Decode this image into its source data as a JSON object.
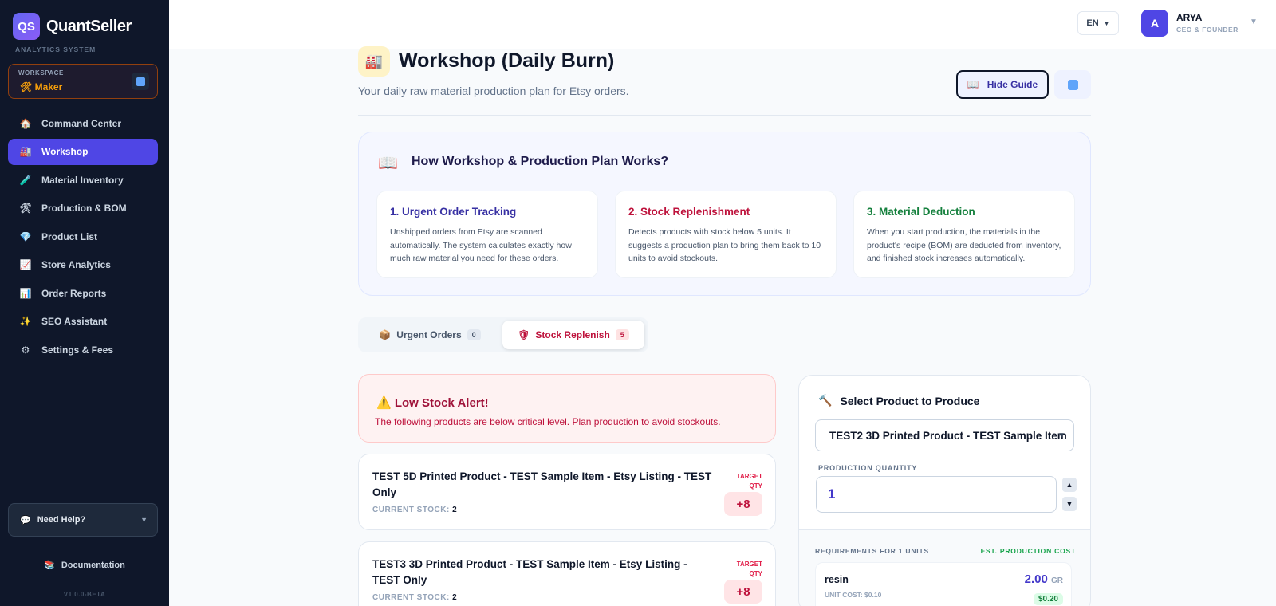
{
  "brand": {
    "logo": "QS",
    "name": "QuantSeller",
    "subtitle": "ANALYTICS SYSTEM"
  },
  "workspace": {
    "label": "WORKSPACE",
    "value": "🛠 Maker"
  },
  "sidebar": {
    "items": [
      {
        "icon": "🏠",
        "label": "Command Center"
      },
      {
        "icon": "🏭",
        "label": "Workshop",
        "active": true
      },
      {
        "icon": "🧪",
        "label": "Material Inventory"
      },
      {
        "icon": "🛠",
        "label": "Production & BOM"
      },
      {
        "icon": "💎",
        "label": "Product List"
      },
      {
        "icon": "📈",
        "label": "Store Analytics"
      },
      {
        "icon": "📊",
        "label": "Order Reports"
      },
      {
        "icon": "✨",
        "label": "SEO Assistant"
      },
      {
        "icon": "⚙",
        "label": "Settings & Fees"
      }
    ],
    "help": "Need Help?",
    "docs": "Documentation",
    "version": "V1.0.0-BETA"
  },
  "topbar": {
    "language": "EN",
    "user": {
      "initial": "A",
      "name": "ARYA",
      "role": "CEO & FOUNDER"
    }
  },
  "header": {
    "icon": "🏭",
    "title": "Workshop (Daily Burn)",
    "subtitle": "Your daily raw material production plan for Etsy orders.",
    "hide_guide": "Hide Guide"
  },
  "guide": {
    "title": "How Workshop & Production Plan Works?",
    "cards": [
      {
        "title": "1. Urgent Order Tracking",
        "text": "Unshipped orders from Etsy are scanned automatically. The system calculates exactly how much raw material you need for these orders.",
        "color": "#3730a3"
      },
      {
        "title": "2. Stock Replenishment",
        "text": "Detects products with stock below 5 units. It suggests a production plan to bring them back to 10 units to avoid stockouts.",
        "color": "#be123c"
      },
      {
        "title": "3. Material Deduction",
        "text": "When you start production, the materials in the product's recipe (BOM) are deducted from inventory, and finished stock increases automatically.",
        "color": "#15803d"
      }
    ]
  },
  "tabs": {
    "urgent": {
      "label": "Urgent Orders",
      "count": "0"
    },
    "stock": {
      "label": "Stock Replenish",
      "count": "5"
    }
  },
  "alert": {
    "title": "Low Stock Alert!",
    "text": "The following products are below critical level. Plan production to avoid stockouts."
  },
  "products": [
    {
      "name": "TEST 5D Printed Product - TEST Sample Item - Etsy Listing - TEST Only",
      "stock_label": "CURRENT STOCK:",
      "stock": "2",
      "target_label": "TARGET QTY",
      "target": "+8"
    },
    {
      "name": "TEST3 3D Printed Product - TEST Sample Item - Etsy Listing - TEST Only",
      "stock_label": "CURRENT STOCK:",
      "stock": "2",
      "target_label": "TARGET QTY",
      "target": "+8"
    }
  ],
  "produce": {
    "title": "Select Product to Produce",
    "selected": "TEST2 3D Printed Product - TEST Sample Item",
    "qty_label": "PRODUCTION QUANTITY",
    "qty": "1",
    "req_label": "REQUIREMENTS FOR 1 UNITS",
    "cost_label": "EST. PRODUCTION COST",
    "material": {
      "name": "resin",
      "unit_cost": "UNIT COST: $0.10",
      "qty": "2.00",
      "unit": "GR",
      "cost": "$0.20"
    }
  }
}
